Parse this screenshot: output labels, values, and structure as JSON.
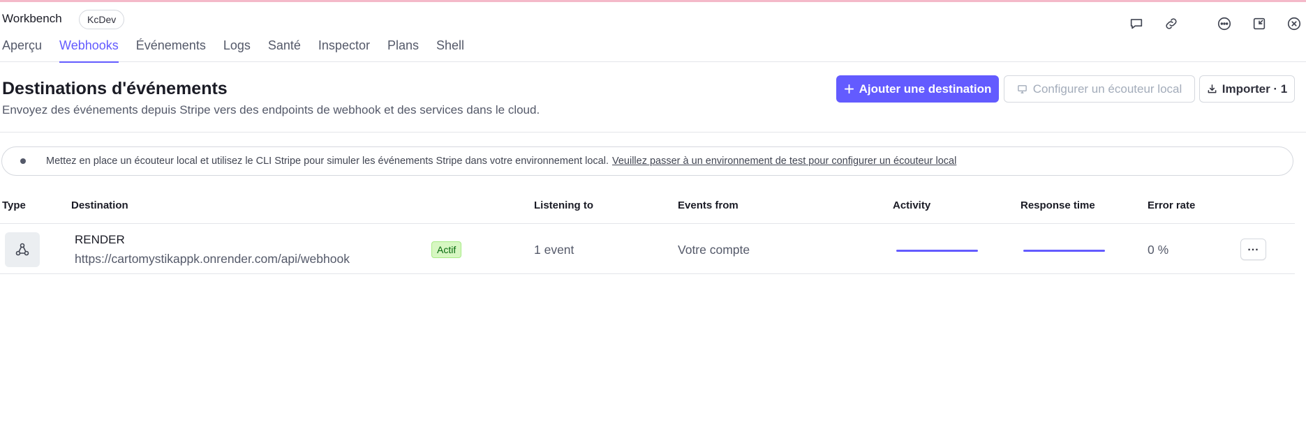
{
  "app": {
    "title": "Workbench",
    "environment_badge": "KcDev"
  },
  "header_icons": [
    "chat-bubble-icon",
    "link-icon",
    "more-options-icon",
    "minimize-icon",
    "close-icon"
  ],
  "tabs": [
    {
      "label": "Aperçu",
      "active": false
    },
    {
      "label": "Webhooks",
      "active": true
    },
    {
      "label": "Événements",
      "active": false
    },
    {
      "label": "Logs",
      "active": false
    },
    {
      "label": "Santé",
      "active": false
    },
    {
      "label": "Inspector",
      "active": false
    },
    {
      "label": "Plans",
      "active": false
    },
    {
      "label": "Shell",
      "active": false
    }
  ],
  "section": {
    "title": "Destinations d'événements",
    "subtitle": "Envoyez des événements depuis Stripe vers des endpoints de webhook et des services dans le cloud."
  },
  "actions": {
    "add_destination": "Ajouter une destination",
    "configure_local_listener": "Configurer un écouteur local",
    "import": "Importer · 1"
  },
  "banner": {
    "text": "Mettez en place un écouteur local et utilisez le CLI Stripe pour simuler les événements Stripe dans votre environnement local.",
    "link": "Veuillez passer à un environnement de test pour configurer un écouteur local"
  },
  "table": {
    "columns": [
      "Type",
      "Destination",
      "Listening to",
      "Events from",
      "Activity",
      "Response time",
      "Error rate"
    ],
    "rows": [
      {
        "type_icon": "webhook-icon",
        "name": "RENDER",
        "url": "https://cartomystikappk.onrender.com/api/webhook",
        "status": "Actif",
        "listening_to": "1 event",
        "events_from": "Votre compte",
        "error_rate": "0 %"
      }
    ]
  },
  "colors": {
    "accent": "#635bff",
    "active_badge_bg": "#d7f7c2",
    "active_badge_text": "#05690d",
    "top_accent": "#f4b9c9"
  }
}
